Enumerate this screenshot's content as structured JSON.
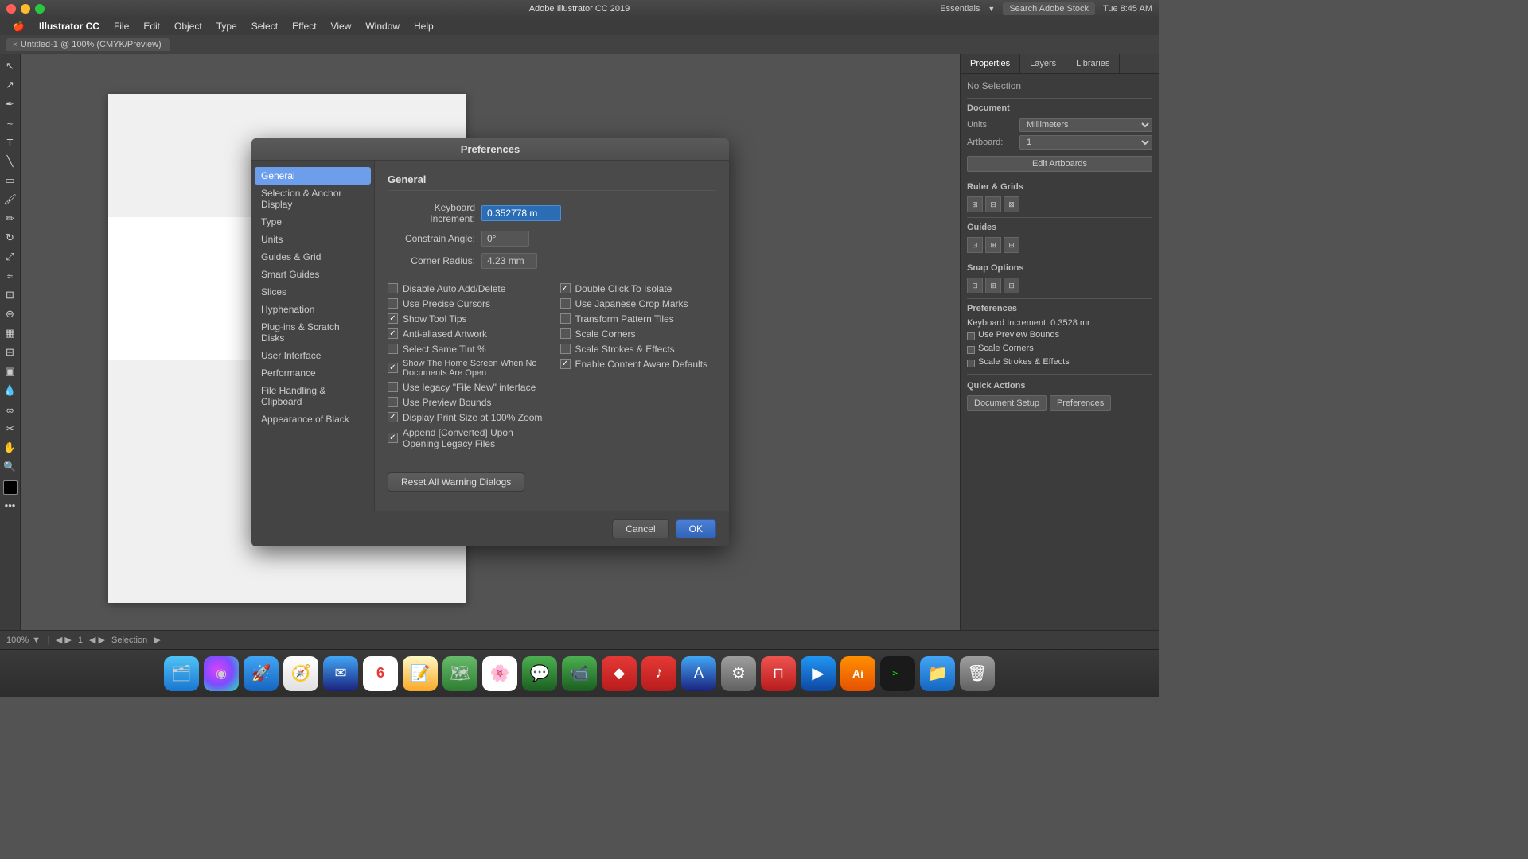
{
  "titlebar": {
    "app_name": "Illustrator CC",
    "title": "Adobe Illustrator CC 2019",
    "time": "Tue 8:45 AM",
    "essentials_label": "Essentials",
    "search_stock_placeholder": "Search Adobe Stock"
  },
  "menubar": {
    "apple_menu": "🍎",
    "items": [
      "Illustrator CC",
      "File",
      "Edit",
      "Object",
      "Type",
      "Select",
      "Effect",
      "View",
      "Window",
      "Help"
    ]
  },
  "tab": {
    "close_icon": "×",
    "label": "Untitled-1 @ 100% (CMYK/Preview)"
  },
  "right_panel": {
    "tabs": [
      "Properties",
      "Layers",
      "Libraries"
    ],
    "no_selection": "No Selection",
    "document_section": "Document",
    "units_label": "Units:",
    "units_value": "Millimeters",
    "artboard_label": "Artboard:",
    "artboard_value": "1",
    "edit_artboards_btn": "Edit Artboards",
    "ruler_grids_label": "Ruler & Grids",
    "guides_label": "Guides",
    "snap_options_label": "Snap Options",
    "preferences_label": "Preferences",
    "keyboard_increment": "Keyboard Increment: 0.3528 mr",
    "use_preview_bounds": "Use Preview Bounds",
    "scale_corners": "Scale Corners",
    "scale_strokes_effects": "Scale Strokes & Effects",
    "quick_actions_label": "Quick Actions",
    "document_setup_btn": "Document Setup",
    "preferences_btn": "Preferences"
  },
  "dialog": {
    "title": "Preferences",
    "sidebar_items": [
      {
        "id": "general",
        "label": "General",
        "active": true
      },
      {
        "id": "selection",
        "label": "Selection & Anchor Display"
      },
      {
        "id": "type",
        "label": "Type"
      },
      {
        "id": "units",
        "label": "Units"
      },
      {
        "id": "guides",
        "label": "Guides & Grid"
      },
      {
        "id": "smart_guides",
        "label": "Smart Guides"
      },
      {
        "id": "slices",
        "label": "Slices"
      },
      {
        "id": "hyphenation",
        "label": "Hyphenation"
      },
      {
        "id": "plugins",
        "label": "Plug-ins & Scratch Disks"
      },
      {
        "id": "user_interface",
        "label": "User Interface"
      },
      {
        "id": "performance",
        "label": "Performance"
      },
      {
        "id": "file_handling",
        "label": "File Handling & Clipboard"
      },
      {
        "id": "appearance",
        "label": "Appearance of Black"
      }
    ],
    "section_title": "General",
    "keyboard_increment_label": "Keyboard Increment:",
    "keyboard_increment_value": "0.352778 m",
    "constrain_angle_label": "Constrain Angle:",
    "constrain_angle_value": "0°",
    "corner_radius_label": "Corner Radius:",
    "corner_radius_value": "4.23 mm",
    "checkboxes_left": [
      {
        "id": "disable_auto",
        "label": "Disable Auto Add/Delete",
        "checked": false
      },
      {
        "id": "use_precise",
        "label": "Use Precise Cursors",
        "checked": false
      },
      {
        "id": "show_tool_tips",
        "label": "Show Tool Tips",
        "checked": true
      },
      {
        "id": "anti_aliased",
        "label": "Anti-aliased Artwork",
        "checked": true
      },
      {
        "id": "select_same_tint",
        "label": "Select Same Tint %",
        "checked": false
      },
      {
        "id": "show_home",
        "label": "Show The Home Screen When No Documents Are Open",
        "checked": true
      },
      {
        "id": "use_legacy",
        "label": "Use legacy \"File New\" interface",
        "checked": false
      },
      {
        "id": "use_preview_bounds",
        "label": "Use Preview Bounds",
        "checked": false
      },
      {
        "id": "display_print_size",
        "label": "Display Print Size at 100% Zoom",
        "checked": true
      },
      {
        "id": "append_converted",
        "label": "Append [Converted] Upon Opening Legacy Files",
        "checked": true
      }
    ],
    "checkboxes_right": [
      {
        "id": "double_click",
        "label": "Double Click To Isolate",
        "checked": true
      },
      {
        "id": "japanese_crop",
        "label": "Use Japanese Crop Marks",
        "checked": false
      },
      {
        "id": "transform_pattern",
        "label": "Transform Pattern Tiles",
        "checked": false
      },
      {
        "id": "scale_corners",
        "label": "Scale Corners",
        "checked": false
      },
      {
        "id": "scale_strokes",
        "label": "Scale Strokes & Effects",
        "checked": false
      },
      {
        "id": "enable_content",
        "label": "Enable Content Aware Defaults",
        "checked": true
      }
    ],
    "reset_btn": "Reset All Warning Dialogs",
    "cancel_btn": "Cancel",
    "ok_btn": "OK"
  },
  "statusbar": {
    "zoom": "100%",
    "artboard_label": "1",
    "mode": "Selection"
  },
  "dock": {
    "items": [
      {
        "id": "finder",
        "label": "🗂",
        "class": "dock-finder"
      },
      {
        "id": "siri",
        "label": "◉",
        "class": "dock-siri"
      },
      {
        "id": "launchpad",
        "label": "🚀",
        "class": "dock-launchpad"
      },
      {
        "id": "safari",
        "label": "🧭",
        "class": "dock-safari"
      },
      {
        "id": "mail",
        "label": "✉",
        "class": "dock-mail"
      },
      {
        "id": "calendar",
        "label": "6",
        "class": "dock-calendar"
      },
      {
        "id": "notes",
        "label": "📝",
        "class": "dock-notes"
      },
      {
        "id": "maps",
        "label": "🗺",
        "class": "dock-maps"
      },
      {
        "id": "photos",
        "label": "🌸",
        "class": "dock-photos"
      },
      {
        "id": "messages",
        "label": "💬",
        "class": "dock-messages"
      },
      {
        "id": "facetime",
        "label": "📹",
        "class": "dock-facetime"
      },
      {
        "id": "fantastical",
        "label": "◆",
        "class": "dock-fantastical"
      },
      {
        "id": "music",
        "label": "♪",
        "class": "dock-music"
      },
      {
        "id": "appstore",
        "label": "A",
        "class": "dock-appstore"
      },
      {
        "id": "prefs",
        "label": "⚙",
        "class": "dock-prefs"
      },
      {
        "id": "magnet",
        "label": "⊓",
        "class": "dock-magnet"
      },
      {
        "id": "imovie",
        "label": "▶",
        "class": "dock-imovie"
      },
      {
        "id": "ai",
        "label": "Ai",
        "class": "dock-ai"
      },
      {
        "id": "terminal",
        "label": ">_",
        "class": "dock-terminal"
      },
      {
        "id": "files",
        "label": "📁",
        "class": "dock-files"
      },
      {
        "id": "trash",
        "label": "🗑",
        "class": "dock-trash"
      }
    ]
  }
}
